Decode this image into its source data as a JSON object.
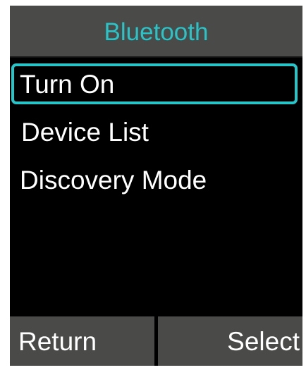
{
  "header": {
    "title": "Bluetooth"
  },
  "menu": {
    "selected_index": 0,
    "items": [
      {
        "label": "Turn On"
      },
      {
        "label": "Device List"
      },
      {
        "label": "Discovery Mode"
      }
    ]
  },
  "softkeys": {
    "left_label": "Return",
    "right_label": "Select"
  },
  "colors": {
    "accent": "#28c4c8",
    "bar_background": "#4a4a48",
    "screen_background": "#000000",
    "text": "#ffffff"
  }
}
